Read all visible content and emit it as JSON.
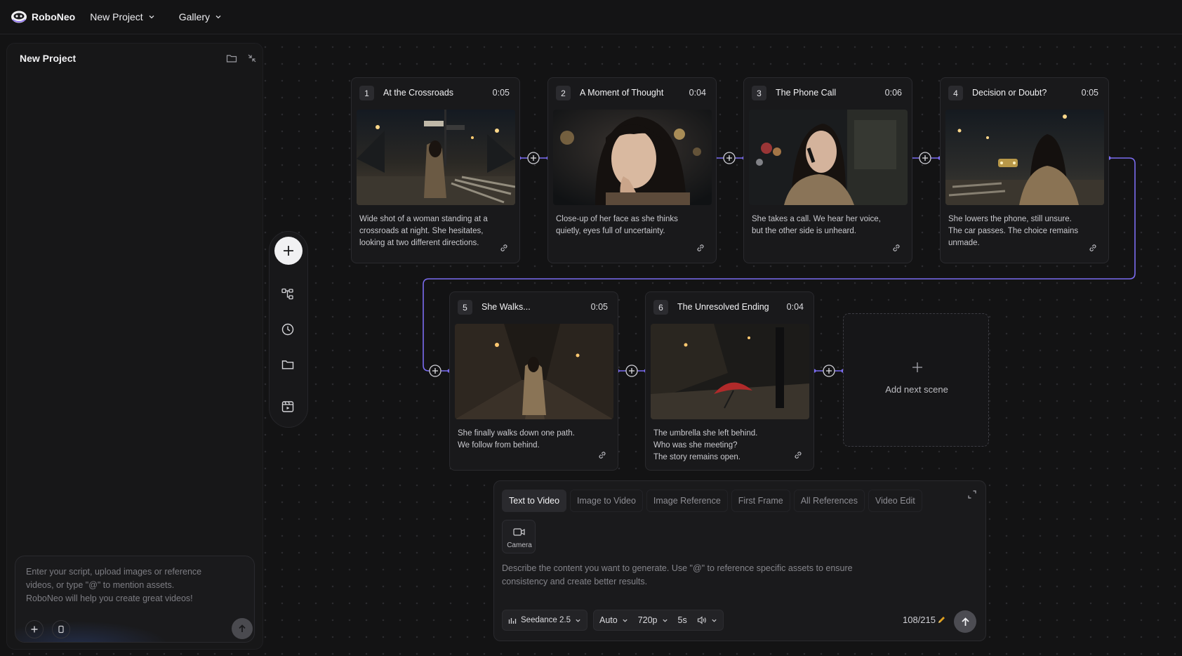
{
  "app": {
    "name": "RoboNeo",
    "project_menu": "New Project",
    "gallery_menu": "Gallery"
  },
  "left_panel": {
    "title": "New Project",
    "placeholder_lines": [
      "Enter your script, upload images or reference",
      "videos, or type \"@\" to mention assets.",
      "RoboNeo will help you create great videos!"
    ]
  },
  "scenes": [
    {
      "number": "1",
      "title": "At the Crossroads",
      "duration": "0:05",
      "description": [
        "Wide shot of a woman standing at a",
        "crossroads at night. She hesitates,",
        "looking at two different directions."
      ]
    },
    {
      "number": "2",
      "title": "A Moment of Thought",
      "duration": "0:04",
      "description": [
        "Close-up of her face as she thinks",
        "quietly, eyes full of uncertainty."
      ]
    },
    {
      "number": "3",
      "title": "The Phone Call",
      "duration": "0:06",
      "description": [
        "She takes a call. We hear her voice,",
        "but the other side is unheard."
      ]
    },
    {
      "number": "4",
      "title": "Decision or Doubt?",
      "duration": "0:05",
      "description": [
        "She lowers the phone, still unsure.",
        "The car passes. The choice remains",
        "unmade."
      ]
    },
    {
      "number": "5",
      "title": "She Walks...",
      "duration": "0:05",
      "description": [
        "She finally walks down one path.",
        "We follow from behind."
      ]
    },
    {
      "number": "6",
      "title": "The Unresolved Ending",
      "duration": "0:04",
      "description": [
        "The umbrella she left behind.",
        "Who was she meeting?",
        "The story remains open."
      ]
    }
  ],
  "add_next_scene": "Add next scene",
  "prompt": {
    "tabs": [
      "Text to Video",
      "Image to Video",
      "Image Reference",
      "First Frame",
      "All References",
      "Video Edit"
    ],
    "active_tab": "Text to Video",
    "camera_label": "Camera",
    "placeholder_lines": [
      "Describe the content you want to generate. Use \"@\" to reference specific assets to ensure",
      "consistency and create better results."
    ],
    "model": "Seedance 2.5",
    "ratio": "Auto",
    "resolution": "720p",
    "length": "5s",
    "counter": "108/215"
  },
  "colors": {
    "accent": "#7b6cf0",
    "background": "#131314",
    "panel": "#171718"
  }
}
